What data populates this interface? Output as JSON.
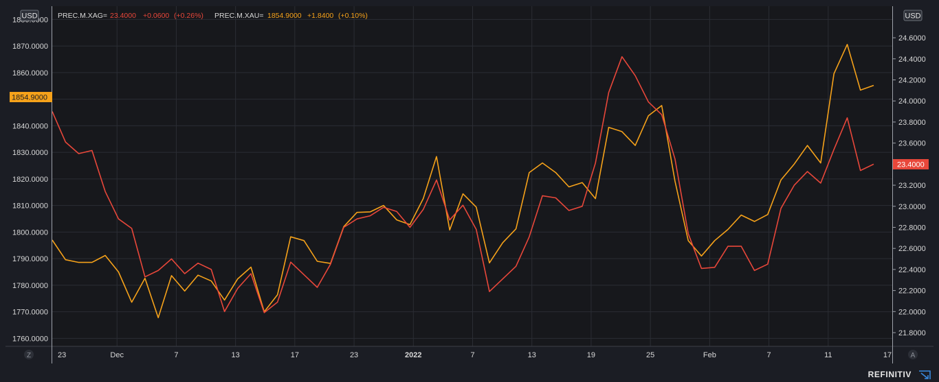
{
  "currency_left": "USD",
  "currency_right": "USD",
  "z_button": "Z",
  "a_button": "A",
  "brand": "REFINITIV",
  "legend": [
    {
      "ric": "PREC.M.XAG=",
      "last": "23.4000",
      "change": "+0.0600",
      "pct": "(+0.26%)",
      "color": "#e8473a"
    },
    {
      "ric": "PREC.M.XAU=",
      "last": "1854.9000",
      "change": "+1.8400",
      "pct": "(+0.10%)",
      "color": "#f6a21a"
    }
  ],
  "left_price_tag": "1854.9000",
  "right_price_tag": "23.4000",
  "colors": {
    "xau": "#f6a21a",
    "xag": "#e8473a",
    "background": "#1b1d24",
    "plot_bg": "#17181c"
  },
  "chart_data": {
    "type": "line",
    "x_tick_labels": [
      "23",
      "Dec",
      "7",
      "13",
      "17",
      "23",
      "2022",
      "7",
      "13",
      "19",
      "25",
      "Feb",
      "7",
      "11",
      "17"
    ],
    "y_left": {
      "ylim": [
        1757,
        1885
      ],
      "ticks": [
        "1760.0000",
        "1770.0000",
        "1780.0000",
        "1790.0000",
        "1800.0000",
        "1810.0000",
        "1820.0000",
        "1830.0000",
        "1840.0000",
        "1850.0000",
        "1860.0000",
        "1870.0000",
        "1880.0000"
      ]
    },
    "y_right": {
      "ylim": [
        21.67,
        24.9
      ],
      "ticks": [
        "21.8000",
        "22.0000",
        "22.2000",
        "22.4000",
        "22.6000",
        "22.8000",
        "23.0000",
        "23.2000",
        "23.4000",
        "23.6000",
        "23.8000",
        "24.0000",
        "24.2000",
        "24.4000",
        "24.6000"
      ]
    },
    "series": [
      {
        "name": "PREC.M.XAU=",
        "axis": "left",
        "values": [
          1797,
          1789.6,
          1788.6,
          1788.6,
          1791.2,
          1785,
          1773.6,
          1782.6,
          1767.8,
          1783.6,
          1777.8,
          1783.8,
          1781.6,
          1774.4,
          1782.4,
          1786.8,
          1770,
          1776.4,
          1798.2,
          1796.8,
          1789,
          1788.2,
          1802,
          1807.4,
          1807.6,
          1810,
          1804.6,
          1802.8,
          1812.6,
          1828.4,
          1800.8,
          1814.4,
          1809.4,
          1788.4,
          1796,
          1801.2,
          1822.4,
          1826,
          1822.4,
          1817,
          1818.6,
          1812.6,
          1839.4,
          1837.8,
          1832.6,
          1843.8,
          1847.6,
          1819.2,
          1796.8,
          1791,
          1796.8,
          1801,
          1806.4,
          1804,
          1806.6,
          1819.6,
          1825.6,
          1832.6,
          1826,
          1859.6,
          1870.6,
          1853.4,
          1855.2
        ]
      },
      {
        "name": "PREC.M.XAG=",
        "axis": "right",
        "values": [
          23.9,
          23.61,
          23.5,
          23.53,
          23.14,
          22.88,
          22.79,
          22.33,
          22.39,
          22.5,
          22.36,
          22.46,
          22.4,
          22.0,
          22.22,
          22.36,
          21.99,
          22.09,
          22.47,
          22.35,
          22.23,
          22.45,
          22.8,
          22.88,
          22.91,
          22.99,
          22.95,
          22.8,
          22.97,
          23.25,
          22.87,
          23.01,
          22.78,
          22.19,
          22.31,
          22.43,
          22.71,
          23.1,
          23.08,
          22.96,
          23.0,
          23.41,
          24.08,
          24.42,
          24.24,
          23.99,
          23.87,
          23.45,
          22.74,
          22.41,
          22.42,
          22.62,
          22.62,
          22.39,
          22.45,
          22.98,
          23.2,
          23.33,
          23.22,
          23.54,
          23.84,
          23.34,
          23.4
        ]
      }
    ]
  }
}
